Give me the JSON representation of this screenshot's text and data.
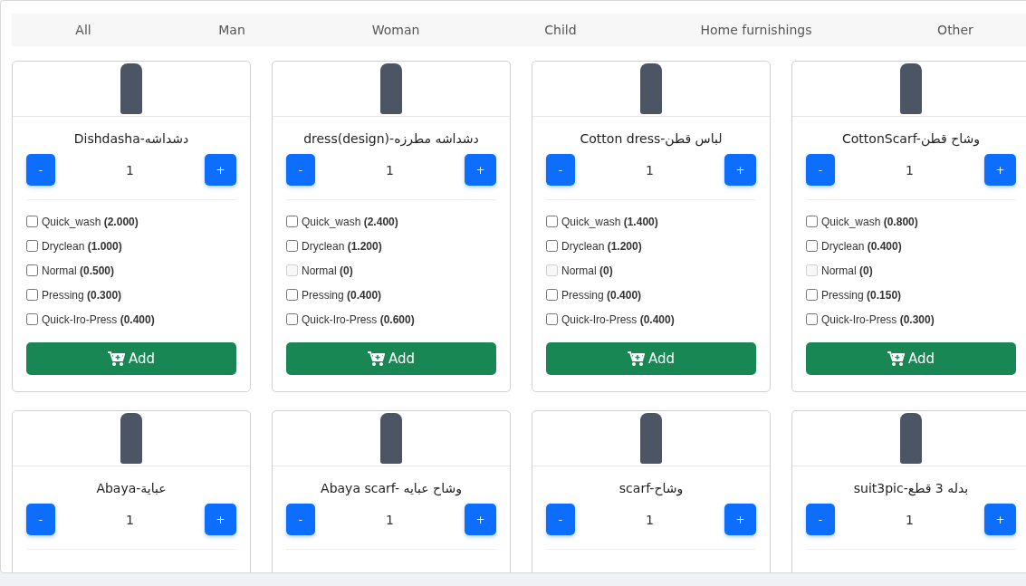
{
  "tabs": [
    {
      "label": "All"
    },
    {
      "label": "Man"
    },
    {
      "label": "Woman"
    },
    {
      "label": "Child"
    },
    {
      "label": "Home furnishings"
    },
    {
      "label": "Other"
    }
  ],
  "products": [
    {
      "title": "Dishdasha-دشداشه",
      "quantity": "1",
      "minus": "-",
      "plus": "+",
      "add": "Add",
      "services": [
        {
          "name": "Quick_wash",
          "price": "(2.000)",
          "checked": false,
          "disabled": false
        },
        {
          "name": "Dryclean",
          "price": "(1.000)",
          "checked": false,
          "disabled": false
        },
        {
          "name": "Normal",
          "price": "(0.500)",
          "checked": false,
          "disabled": false
        },
        {
          "name": "Pressing",
          "price": "(0.300)",
          "checked": false,
          "disabled": false
        },
        {
          "name": "Quick-Iro-Press",
          "price": "(0.400)",
          "checked": false,
          "disabled": false
        }
      ]
    },
    {
      "title": "dress(design)-دشداشه مطرزه",
      "quantity": "1",
      "minus": "-",
      "plus": "+",
      "add": "Add",
      "services": [
        {
          "name": "Quick_wash",
          "price": "(2.400)",
          "checked": false,
          "disabled": false
        },
        {
          "name": "Dryclean",
          "price": "(1.200)",
          "checked": false,
          "disabled": false
        },
        {
          "name": "Normal",
          "price": "(0)",
          "checked": false,
          "disabled": true
        },
        {
          "name": "Pressing",
          "price": "(0.400)",
          "checked": false,
          "disabled": false
        },
        {
          "name": "Quick-Iro-Press",
          "price": "(0.600)",
          "checked": false,
          "disabled": false
        }
      ]
    },
    {
      "title": "Cotton dress-لباس قطن",
      "quantity": "1",
      "minus": "-",
      "plus": "+",
      "add": "Add",
      "services": [
        {
          "name": "Quick_wash",
          "price": "(1.400)",
          "checked": false,
          "disabled": false
        },
        {
          "name": "Dryclean",
          "price": "(1.200)",
          "checked": false,
          "disabled": false
        },
        {
          "name": "Normal",
          "price": "(0)",
          "checked": false,
          "disabled": true
        },
        {
          "name": "Pressing",
          "price": "(0.400)",
          "checked": false,
          "disabled": false
        },
        {
          "name": "Quick-Iro-Press",
          "price": "(0.400)",
          "checked": false,
          "disabled": false
        }
      ]
    },
    {
      "title": "CottonScarf-وشاح قطن",
      "quantity": "1",
      "minus": "-",
      "plus": "+",
      "add": "Add",
      "services": [
        {
          "name": "Quick_wash",
          "price": "(0.800)",
          "checked": false,
          "disabled": false
        },
        {
          "name": "Dryclean",
          "price": "(0.400)",
          "checked": false,
          "disabled": false
        },
        {
          "name": "Normal",
          "price": "(0)",
          "checked": false,
          "disabled": true
        },
        {
          "name": "Pressing",
          "price": "(0.150)",
          "checked": false,
          "disabled": false
        },
        {
          "name": "Quick-Iro-Press",
          "price": "(0.300)",
          "checked": false,
          "disabled": false
        }
      ]
    },
    {
      "title": "Abaya-عباية",
      "quantity": "1",
      "minus": "-",
      "plus": "+"
    },
    {
      "title": "Abaya scarf- وشاح عبايه",
      "quantity": "1",
      "minus": "-",
      "plus": "+"
    },
    {
      "title": "scarf-وشاح",
      "quantity": "1",
      "minus": "-",
      "plus": "+"
    },
    {
      "title": "suit3pic-بدله 3 قطع",
      "quantity": "1",
      "minus": "-",
      "plus": "+"
    }
  ]
}
